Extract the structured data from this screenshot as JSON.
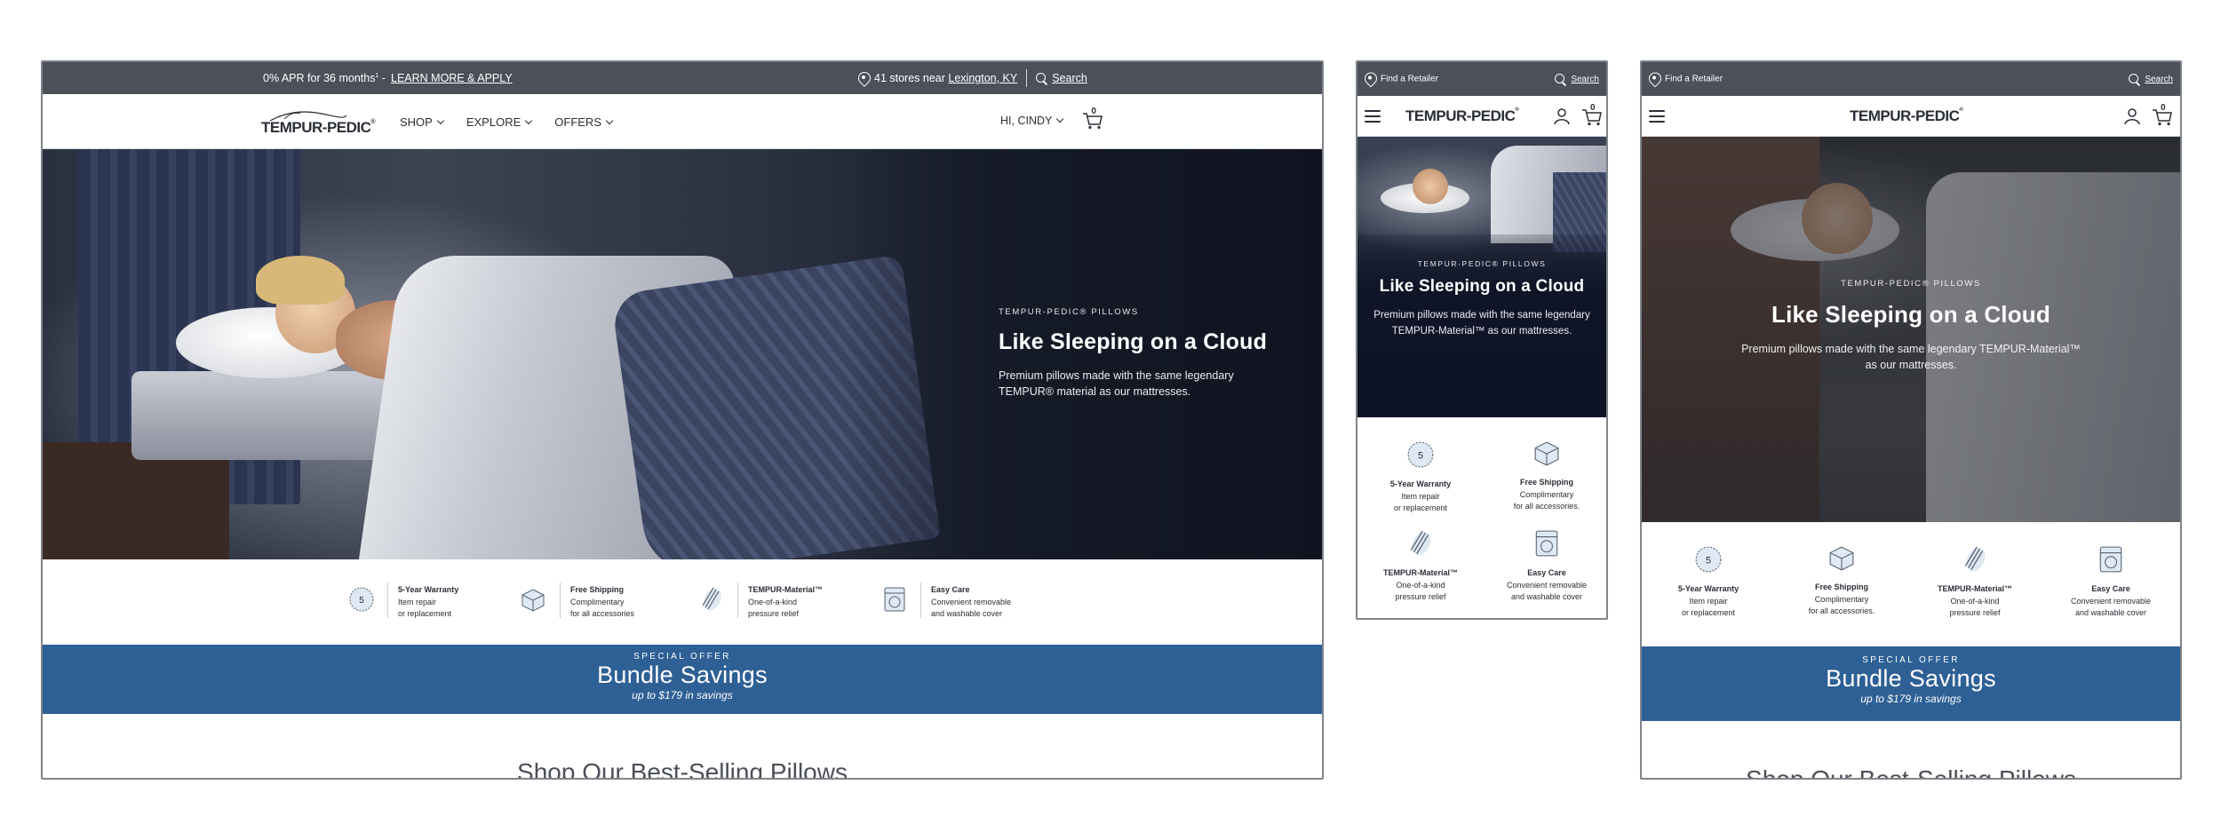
{
  "desktop": {
    "promo_left_text": "0% APR for 36 months",
    "promo_sup": "1",
    "promo_dash": " - ",
    "promo_link": "LEARN MORE & APPLY",
    "stores_text": "41 stores near ",
    "stores_link": "Lexington, KY",
    "search_label": "Search",
    "logo_text": "TEMPUR-PEDIC",
    "nav_items": [
      "SHOP",
      "EXPLORE",
      "OFFERS"
    ],
    "user_greeting": "HI, CINDY",
    "cart_count": "0",
    "hero_eyebrow": "TEMPUR-PEDIC® PILLOWS",
    "hero_headline": "Like Sleeping on a Cloud",
    "hero_sub": "Premium pillows made with the same legendary TEMPUR® material as our mattresses.",
    "features": [
      {
        "title": "5-Year Warranty",
        "line1": "Item repair",
        "line2": "or replacement",
        "icon": "warranty-5-icon"
      },
      {
        "title": "Free Shipping",
        "line1": "Complimentary",
        "line2": "for all accessories",
        "icon": "shipping-box-icon"
      },
      {
        "title": "TEMPUR-Material™",
        "line1": "One-of-a-kind",
        "line2": "pressure relief",
        "icon": "material-layers-icon"
      },
      {
        "title": "Easy Care",
        "line1": "Convenient removable",
        "line2": "and washable cover",
        "icon": "washing-machine-icon"
      }
    ],
    "offer_eyebrow": "SPECIAL OFFER",
    "offer_title": "Bundle Savings",
    "offer_sub": "up to $179 in savings",
    "section_heading": "Shop Our Best-Selling Pillows"
  },
  "mobile": {
    "find_retailer": "Find a Retailer",
    "search_label": "Search",
    "logo_text": "TEMPUR-PEDIC",
    "cart_count": "0",
    "hero_eyebrow": "TEMPUR-PEDIC® PILLOWS",
    "hero_headline": "Like Sleeping on a Cloud",
    "hero_sub": "Premium pillows made with the same legendary TEMPUR-Material™ as our mattresses.",
    "features": [
      {
        "title": "5-Year Warranty",
        "line1": "Item repair",
        "line2": "or replacement"
      },
      {
        "title": "Free Shipping",
        "line1": "Complimentary",
        "line2": "for all accessories."
      },
      {
        "title": "TEMPUR-Material™",
        "line1": "One-of-a-kind",
        "line2": "pressure relief"
      },
      {
        "title": "Easy Care",
        "line1": "Convenient removable",
        "line2": "and washable cover"
      }
    ]
  },
  "tablet": {
    "find_retailer": "Find a Retailer",
    "search_label": "Search",
    "logo_text": "TEMPUR-PEDIC",
    "cart_count": "0",
    "hero_eyebrow": "TEMPUR-PEDIC® PILLOWS",
    "hero_headline": "Like Sleeping on a Cloud",
    "hero_sub": "Premium pillows made with the same legendary TEMPUR-Material™ as our mattresses.",
    "features": [
      {
        "title": "5-Year Warranty",
        "line1": "Item repair",
        "line2": "or replacement"
      },
      {
        "title": "Free Shipping",
        "line1": "Complimentary",
        "line2": "for all accessories."
      },
      {
        "title": "TEMPUR-Material™",
        "line1": "One-of-a-kind",
        "line2": "pressure relief"
      },
      {
        "title": "Easy Care",
        "line1": "Convenient removable",
        "line2": "and washable cover"
      }
    ],
    "offer_eyebrow": "SPECIAL OFFER",
    "offer_title": "Bundle Savings",
    "offer_sub": "up to $179 in savings",
    "section_heading": "Shop Our Best-Selling Pillows"
  },
  "colors": {
    "promo_bar": "#4b5059",
    "offer_blue": "#2e6095",
    "hero_dark": "#1a1f2c",
    "knit_navy": "#3b4560"
  }
}
